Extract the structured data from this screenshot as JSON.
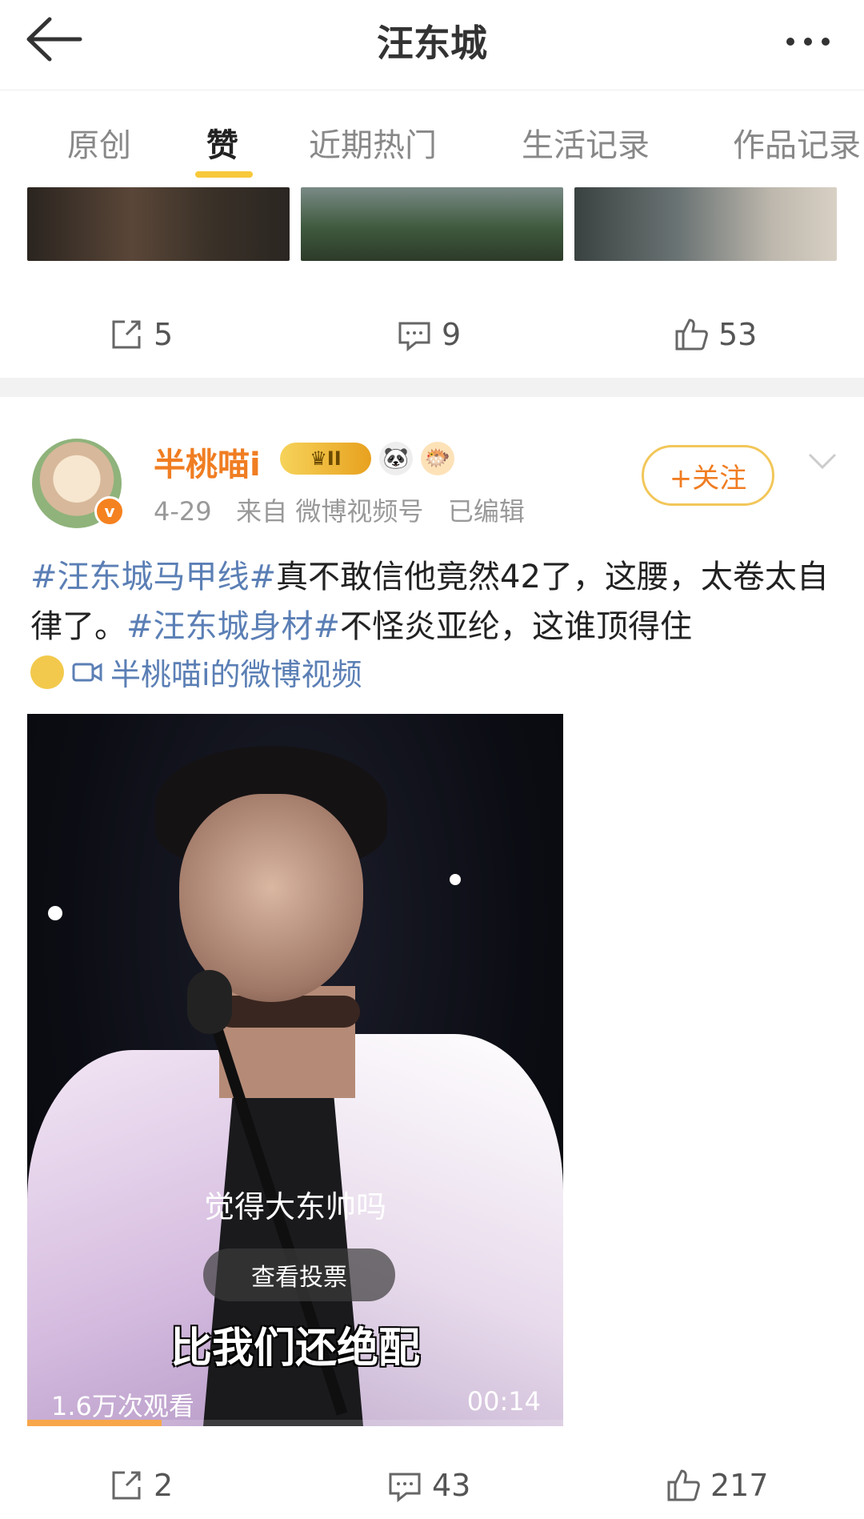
{
  "header": {
    "title": "汪东城"
  },
  "tabs": [
    {
      "label": "原创"
    },
    {
      "label": "赞"
    },
    {
      "label": "近期热门"
    },
    {
      "label": "生活记录"
    },
    {
      "label": "作品记录"
    }
  ],
  "prev_post": {
    "repost_count": "5",
    "comment_count": "9",
    "like_count": "53"
  },
  "post": {
    "username": "半桃喵i",
    "vip_level": "II",
    "date": "4-29",
    "source_prefix": "来自",
    "source": "微博视频号",
    "edited": "已编辑",
    "follow_label": "+关注",
    "text": {
      "tag1": "#汪东城马甲线#",
      "part1": "真不敢信他竟然42了，这腰，太卷太自律了。",
      "tag2": "#汪东城身材#",
      "part2": "不怪炎亚纶，这谁顶得住"
    },
    "video_link": "半桃喵i的微博视频",
    "video": {
      "vote_question": "觉得大东帅吗",
      "vote_button": "查看投票",
      "subtitle": "比我们还绝配",
      "views": "1.6万次观看",
      "duration": "00:14",
      "progress": 0.25
    },
    "repost_count": "2",
    "comment_count": "43",
    "like_count": "217"
  },
  "colors": {
    "accent_orange": "#f07d22",
    "link_blue": "#5b7fb5",
    "tab_underline": "#f7c93a"
  }
}
